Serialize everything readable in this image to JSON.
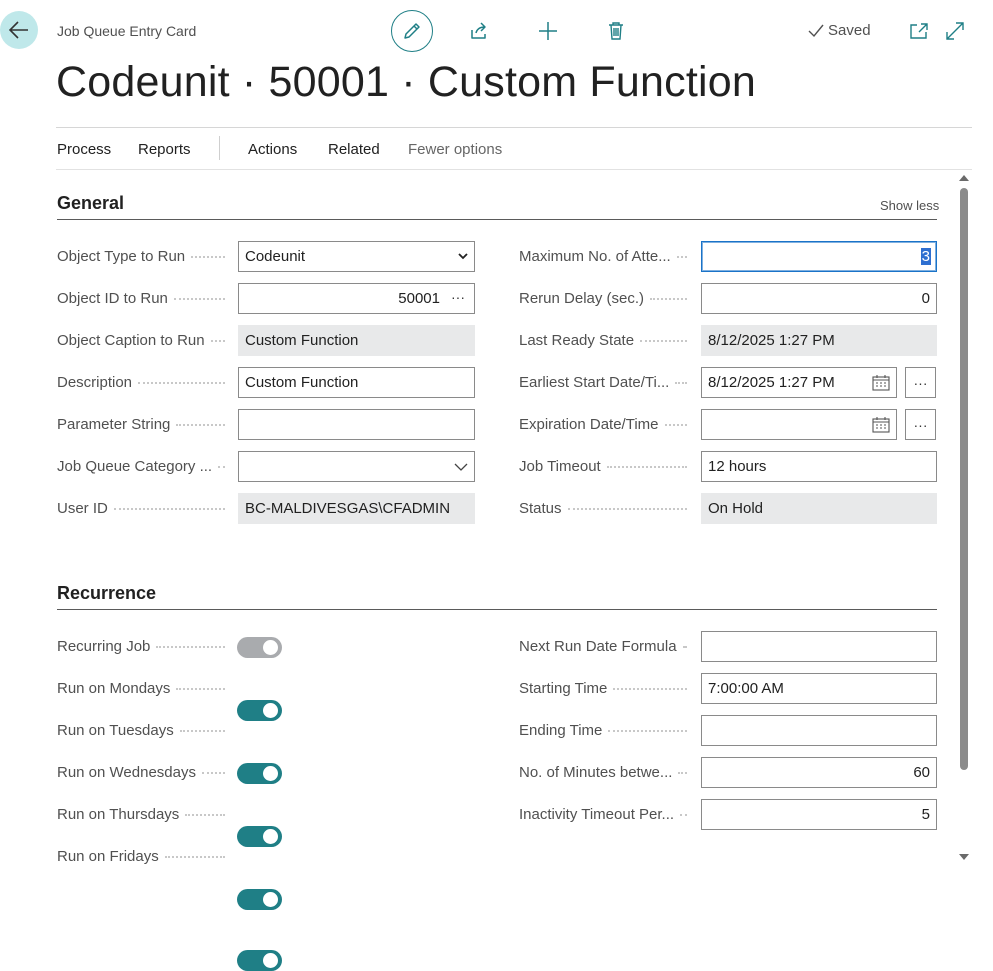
{
  "header": {
    "breadcrumb": "Job Queue Entry Card",
    "title": "Codeunit · 50001 · Custom Function",
    "saved_label": "Saved"
  },
  "menu": {
    "items": [
      "Process",
      "Reports",
      "Actions",
      "Related",
      "Fewer options"
    ]
  },
  "general": {
    "title": "General",
    "show_less": "Show less",
    "left": [
      {
        "label": "Object Type to Run",
        "value": "Codeunit"
      },
      {
        "label": "Object ID to Run",
        "value": "50001"
      },
      {
        "label": "Object Caption to Run",
        "value": "Custom Function"
      },
      {
        "label": "Description",
        "value": "Custom Function"
      },
      {
        "label": "Parameter String",
        "value": ""
      },
      {
        "label": "Job Queue Category ...",
        "value": ""
      },
      {
        "label": "User ID",
        "value": "BC-MALDIVESGAS\\CFADMIN"
      }
    ],
    "right": [
      {
        "label": "Maximum No. of Atte...",
        "value": "3"
      },
      {
        "label": "Rerun Delay (sec.)",
        "value": "0"
      },
      {
        "label": "Last Ready State",
        "value": "8/12/2025 1:27 PM"
      },
      {
        "label": "Earliest Start Date/Ti...",
        "value": "8/12/2025 1:27 PM"
      },
      {
        "label": "Expiration Date/Time",
        "value": ""
      },
      {
        "label": "Job Timeout",
        "value": "12 hours"
      },
      {
        "label": "Status",
        "value": "On Hold"
      }
    ]
  },
  "recurrence": {
    "title": "Recurrence",
    "left": [
      {
        "label": "Recurring Job",
        "on": true,
        "disabled": true
      },
      {
        "label": "Run on Mondays",
        "on": true
      },
      {
        "label": "Run on Tuesdays",
        "on": true
      },
      {
        "label": "Run on Wednesdays",
        "on": true
      },
      {
        "label": "Run on Thursdays",
        "on": true
      },
      {
        "label": "Run on Fridays",
        "on": true
      }
    ],
    "right": [
      {
        "label": "Next Run Date Formula",
        "value": ""
      },
      {
        "label": "Starting Time",
        "value": "7:00:00 AM"
      },
      {
        "label": "Ending Time",
        "value": ""
      },
      {
        "label": "No. of Minutes betwe...",
        "value": "60"
      },
      {
        "label": "Inactivity Timeout Per...",
        "value": "5"
      }
    ]
  },
  "colors": {
    "accent": "#1f7f86",
    "back_button_bg": "#bfe8ea",
    "readonly_field": "#e8e9ea",
    "toggle_disabled": "#a9abae"
  },
  "icons": {
    "back": "arrow-left-icon",
    "edit": "pencil-icon",
    "share": "share-icon",
    "new": "plus-icon",
    "delete": "trash-icon",
    "saved": "checkmark-icon",
    "open_new": "open-in-new-window-icon",
    "expand": "expand-icon",
    "calendar": "calendar-icon",
    "lookup": "ellipsis-icon",
    "dropdown": "chevron-down-icon"
  }
}
